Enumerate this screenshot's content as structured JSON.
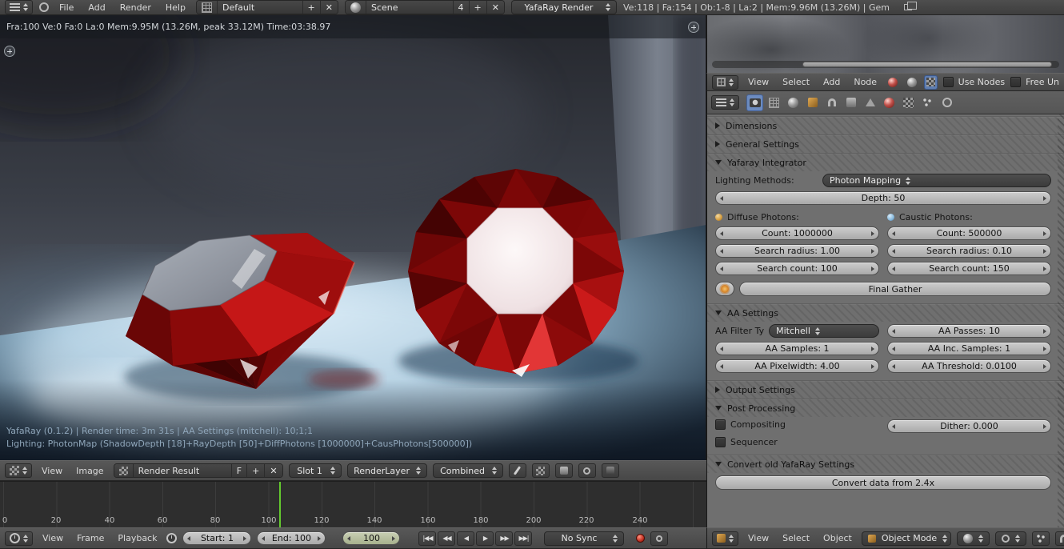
{
  "colors": {
    "accent_blue": "#6c8bbf",
    "gem_red": "#a80f0f",
    "playhead_green": "#64c92e",
    "record_red": "#c23122",
    "header_gray": "#4f4f4f",
    "panel_gray": "#6f6f6f"
  },
  "icons": {
    "plus": "+",
    "close": "✕"
  },
  "info_bar": {
    "menus": [
      "File",
      "Add",
      "Render",
      "Help"
    ],
    "screen_name": "Default",
    "scene_name": "Scene",
    "scene_users": "4",
    "engine": "YafaRay Render",
    "stats": "Ve:118 | Fa:154 | Ob:1-8 | La:2 | Mem:9.96M (13.26M) | Gem"
  },
  "render_view": {
    "stats": "Fra:100 Ve:0 Fa:0 La:0 Mem:9.95M (13.26M, peak 33.12M) Time:03:38.97",
    "footer_line1": "YafaRay (0.1.2) | Render time: 3m 31s | AA Settings (mitchell): 10;1;1",
    "footer_line2": "Lighting: PhotonMap (ShadowDepth [18]+RayDepth [50]+DiffPhotons [1000000]+CausPhotons[500000])"
  },
  "node_editor": {
    "menus": [
      "View",
      "Select",
      "Add",
      "Node"
    ],
    "use_nodes_label": "Use Nodes",
    "free_unlinked_label": "Free Un"
  },
  "properties": {
    "panel_dimensions": "Dimensions",
    "panel_general": "General Settings",
    "panel_integrator": "Yafaray Integrator",
    "panel_aa": "AA Settings",
    "panel_output": "Output Settings",
    "panel_post": "Post Processing",
    "panel_convert": "Convert old YafaRay Settings",
    "lighting_methods_label": "Lighting Methods:",
    "lighting_method": "Photon Mapping",
    "depth": "Depth: 50",
    "diffuse_label": "Diffuse Photons:",
    "caustic_label": "Caustic Photons:",
    "diffuse_count": "Count: 1000000",
    "diffuse_radius": "Search radius: 1.00",
    "diffuse_search_count": "Search count: 100",
    "caustic_count": "Count: 500000",
    "caustic_radius": "Search radius: 0.10",
    "caustic_search_count": "Search count: 150",
    "final_gather": "Final Gather",
    "aa_filter_label": "AA Filter Ty",
    "aa_filter_value": "Mitchell",
    "aa_passes": "AA Passes: 10",
    "aa_samples": "AA Samples: 1",
    "aa_inc_samples": "AA Inc. Samples: 1",
    "aa_pixelwidth": "AA Pixelwidth: 4.00",
    "aa_threshold": "AA Threshold: 0.0100",
    "compositing_label": "Compositing",
    "sequencer_label": "Sequencer",
    "dither": "Dither: 0.000",
    "convert_button": "Convert data from 2.4x"
  },
  "image_editor": {
    "menus": [
      "View",
      "Image"
    ],
    "datablock": "Render Result",
    "fake_user": "F",
    "slot": "Slot 1",
    "layer": "RenderLayer",
    "pass": "Combined"
  },
  "timeline": {
    "menus": [
      "View",
      "Frame",
      "Playback"
    ],
    "ticks": [
      "0",
      "20",
      "40",
      "60",
      "80",
      "100",
      "120",
      "140",
      "160",
      "180",
      "200",
      "220",
      "240"
    ],
    "start": "Start: 1",
    "end": "End: 100",
    "current": "100",
    "sync": "No Sync",
    "controls": [
      "|◀◀",
      "◀◀",
      "◀",
      "▶",
      "▶▶",
      "▶▶|"
    ]
  },
  "view3d": {
    "menus": [
      "View",
      "Select",
      "Object"
    ],
    "mode": "Object Mode"
  }
}
